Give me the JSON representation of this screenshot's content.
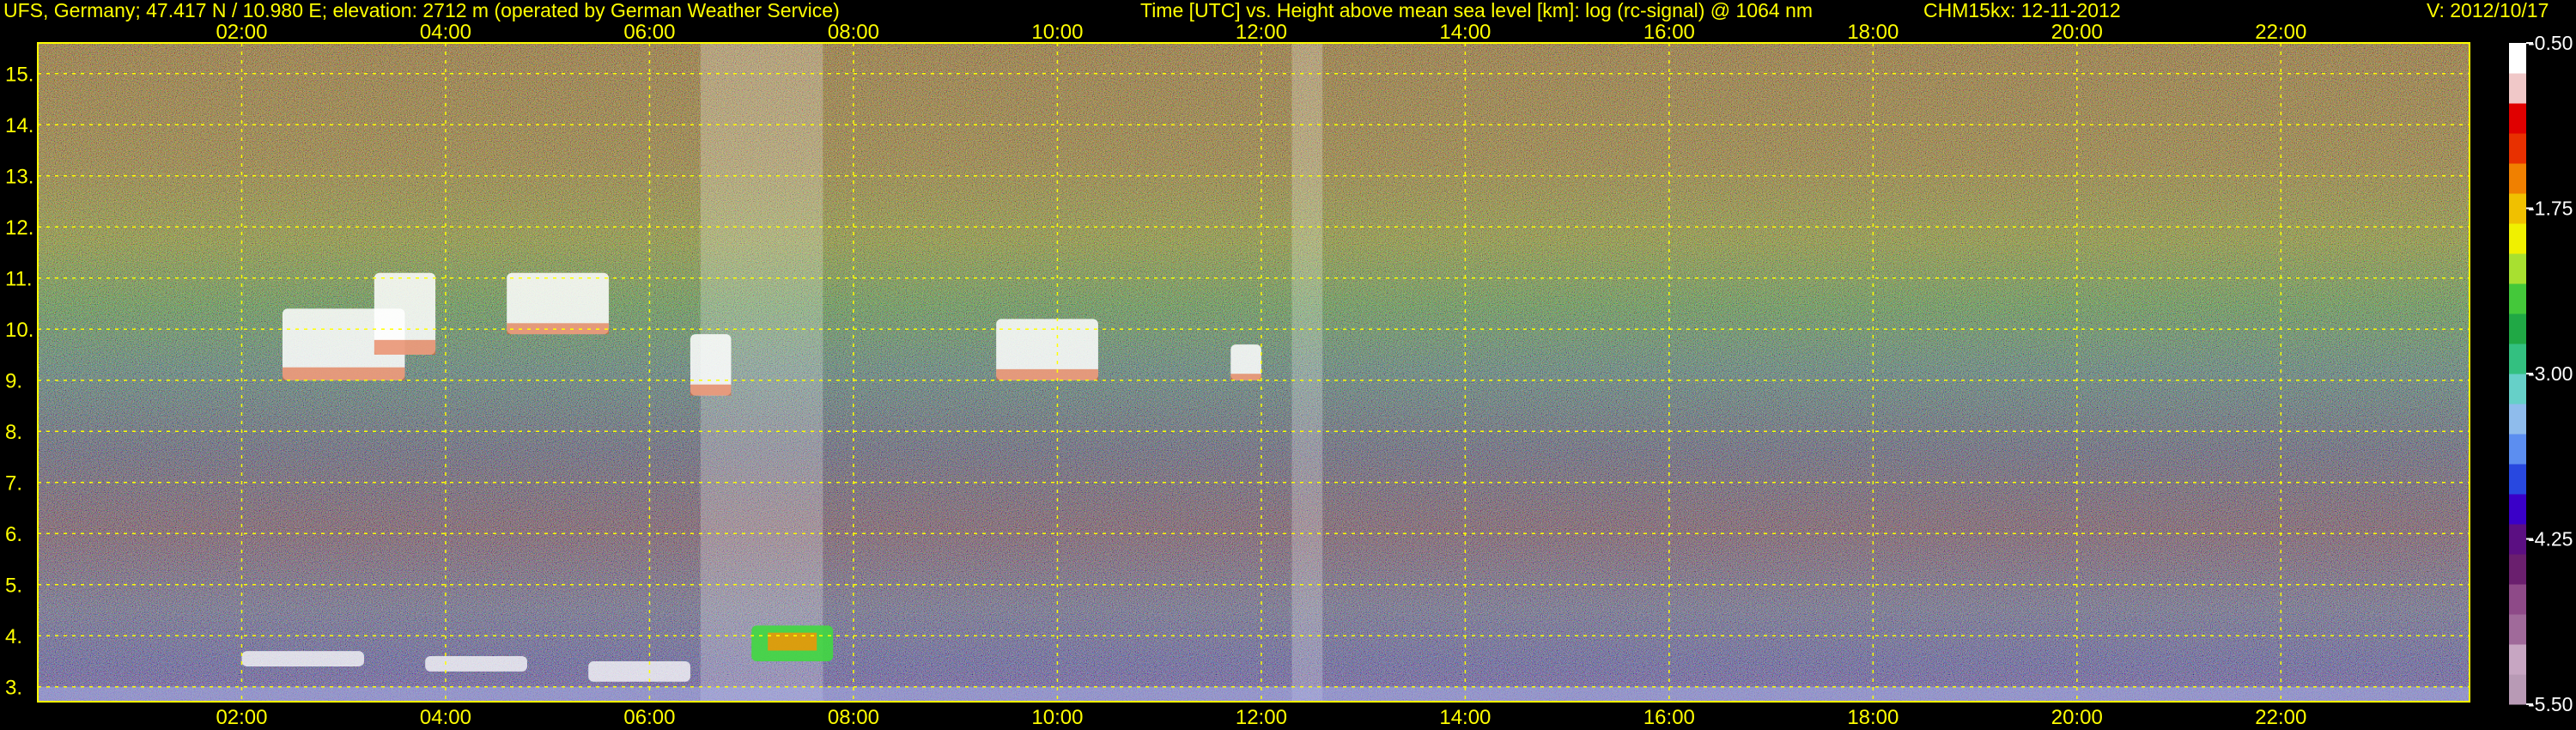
{
  "header": {
    "station": "UFS, Germany; 47.417 N / 10.980 E; elevation: 2712 m  (operated by German Weather Service)",
    "title": "Time [UTC] vs. Height above mean sea level [km]: log (rc-signal) @ 1064 nm",
    "instrument": "CHM15kx: 12-11-2012",
    "version": "V: 2012/10/17"
  },
  "chart_data": {
    "type": "heatmap",
    "title": "Time [UTC] vs. Height above mean sea level [km]: log (rc-signal) @ 1064 nm",
    "xlabel": "",
    "ylabel": "",
    "x_unit": "hour UTC",
    "y_unit": "km",
    "xlim": [
      0.0,
      23.85
    ],
    "ylim": [
      2.71,
      15.6
    ],
    "x_ticks": [
      {
        "value": 2,
        "label": "02:00"
      },
      {
        "value": 4,
        "label": "04:00"
      },
      {
        "value": 6,
        "label": "06:00"
      },
      {
        "value": 8,
        "label": "08:00"
      },
      {
        "value": 10,
        "label": "10:00"
      },
      {
        "value": 12,
        "label": "12:00"
      },
      {
        "value": 14,
        "label": "14:00"
      },
      {
        "value": 16,
        "label": "16:00"
      },
      {
        "value": 18,
        "label": "18:00"
      },
      {
        "value": 20,
        "label": "20:00"
      },
      {
        "value": 22,
        "label": "22:00"
      }
    ],
    "y_ticks": [
      {
        "value": 3,
        "label": "3."
      },
      {
        "value": 4,
        "label": "4."
      },
      {
        "value": 5,
        "label": "5."
      },
      {
        "value": 6,
        "label": "6."
      },
      {
        "value": 7,
        "label": "7."
      },
      {
        "value": 8,
        "label": "8."
      },
      {
        "value": 9,
        "label": "9."
      },
      {
        "value": 10,
        "label": "10."
      },
      {
        "value": 11,
        "label": "11."
      },
      {
        "value": 12,
        "label": "12."
      },
      {
        "value": 13,
        "label": "13."
      },
      {
        "value": 14,
        "label": "14."
      },
      {
        "value": 15,
        "label": "15."
      }
    ],
    "grid": true,
    "grid_color": "#ffff00",
    "colorbar": {
      "range": [
        -5.5,
        -0.5
      ],
      "ticks": [
        {
          "value": -0.5,
          "label": "-0.50"
        },
        {
          "value": -1.75,
          "label": "-1.75"
        },
        {
          "value": -3.0,
          "label": "-3.00"
        },
        {
          "value": -4.25,
          "label": "-4.25"
        },
        {
          "value": -5.5,
          "label": "-5.50"
        }
      ],
      "colors": [
        "#b89ab5",
        "#c7a6c2",
        "#a06a9a",
        "#8e4a88",
        "#6a1f6e",
        "#5b0f82",
        "#3a00c8",
        "#2848e0",
        "#5c8ef0",
        "#8fbcec",
        "#66d0c8",
        "#33c080",
        "#20a845",
        "#44c83a",
        "#a8e030",
        "#f0f000",
        "#f0c000",
        "#f08000",
        "#e83000",
        "#e00000",
        "#f0c8c8",
        "#ffffff"
      ]
    },
    "features": [
      {
        "name": "cirrus",
        "x_range": [
          2.4,
          3.6
        ],
        "y_range": [
          9.0,
          10.4
        ]
      },
      {
        "name": "cirrus",
        "x_range": [
          3.3,
          3.9
        ],
        "y_range": [
          9.5,
          11.1
        ]
      },
      {
        "name": "cirrus",
        "x_range": [
          4.6,
          5.6
        ],
        "y_range": [
          9.9,
          11.1
        ]
      },
      {
        "name": "cirrus",
        "x_range": [
          6.4,
          6.8
        ],
        "y_range": [
          8.7,
          9.9
        ]
      },
      {
        "name": "cirrus",
        "x_range": [
          9.4,
          10.4
        ],
        "y_range": [
          9.0,
          10.2
        ]
      },
      {
        "name": "cirrus",
        "x_range": [
          11.7,
          12.0
        ],
        "y_range": [
          9.0,
          9.7
        ]
      },
      {
        "name": "low cloud",
        "x_range": [
          7.0,
          7.8
        ],
        "y_range": [
          3.5,
          4.2
        ]
      },
      {
        "name": "boundary layer top",
        "x_range": [
          2.0,
          3.2
        ],
        "y_range": [
          3.4,
          3.7
        ]
      },
      {
        "name": "boundary layer top",
        "x_range": [
          3.8,
          4.8
        ],
        "y_range": [
          3.3,
          3.6
        ]
      },
      {
        "name": "boundary layer top",
        "x_range": [
          5.4,
          6.4
        ],
        "y_range": [
          3.1,
          3.5
        ]
      }
    ],
    "noisy_periods": [
      {
        "x_range": [
          6.5,
          7.7
        ]
      },
      {
        "x_range": [
          12.3,
          12.6
        ]
      }
    ]
  }
}
